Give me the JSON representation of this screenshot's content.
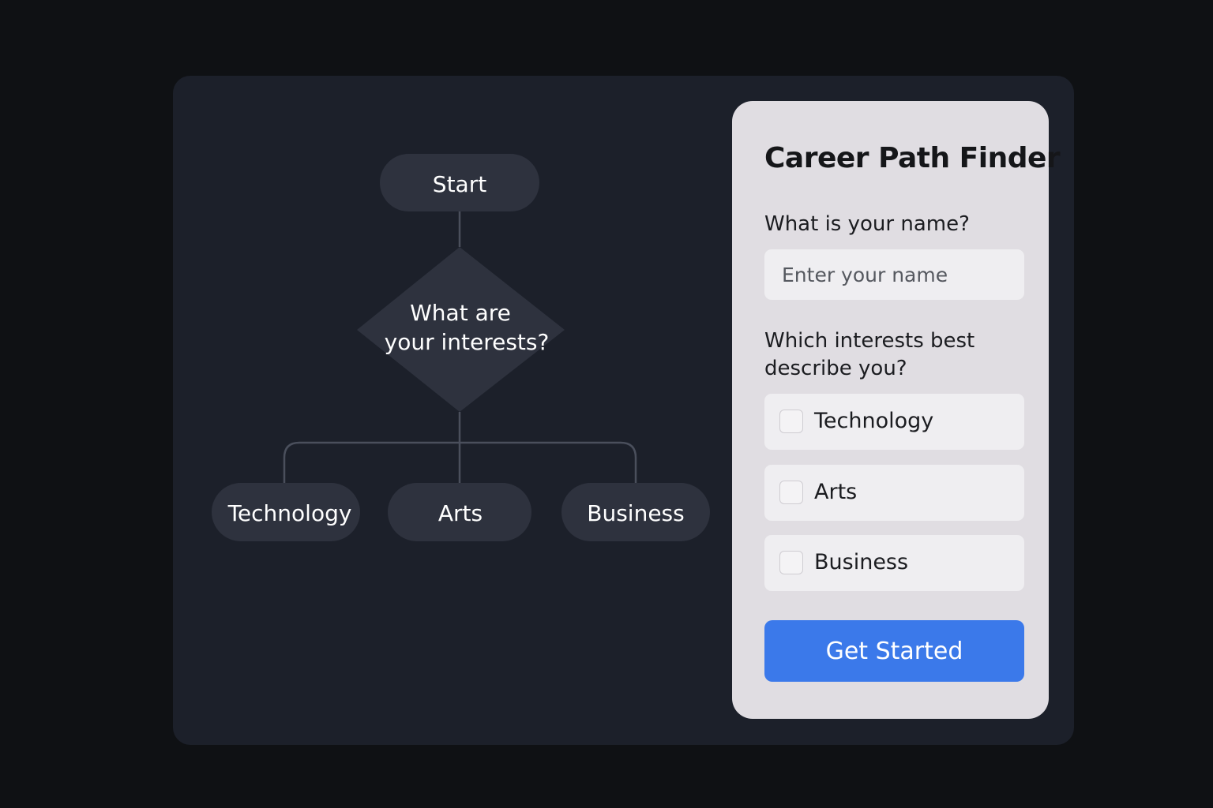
{
  "flowchart": {
    "start": "Start",
    "question_line1": "What are",
    "question_line2": "your interests?",
    "options": [
      "Technology",
      "Arts",
      "Business"
    ]
  },
  "form": {
    "title": "Career Path Finder",
    "name_label": "What is your name?",
    "name_placeholder": "Enter your name",
    "name_value": "",
    "interests_label_line1": "Which interests best",
    "interests_label_line2": "describe you?",
    "interests": [
      {
        "label": "Technology",
        "checked": false
      },
      {
        "label": "Arts",
        "checked": false
      },
      {
        "label": "Business",
        "checked": false
      }
    ],
    "submit_label": "Get Started"
  },
  "colors": {
    "background": "#0f1114",
    "card": "#1c202a",
    "node": "#2e323e",
    "connector": "#4a4f5c",
    "panel": "#e0dde2",
    "accent": "#3b79ea"
  }
}
